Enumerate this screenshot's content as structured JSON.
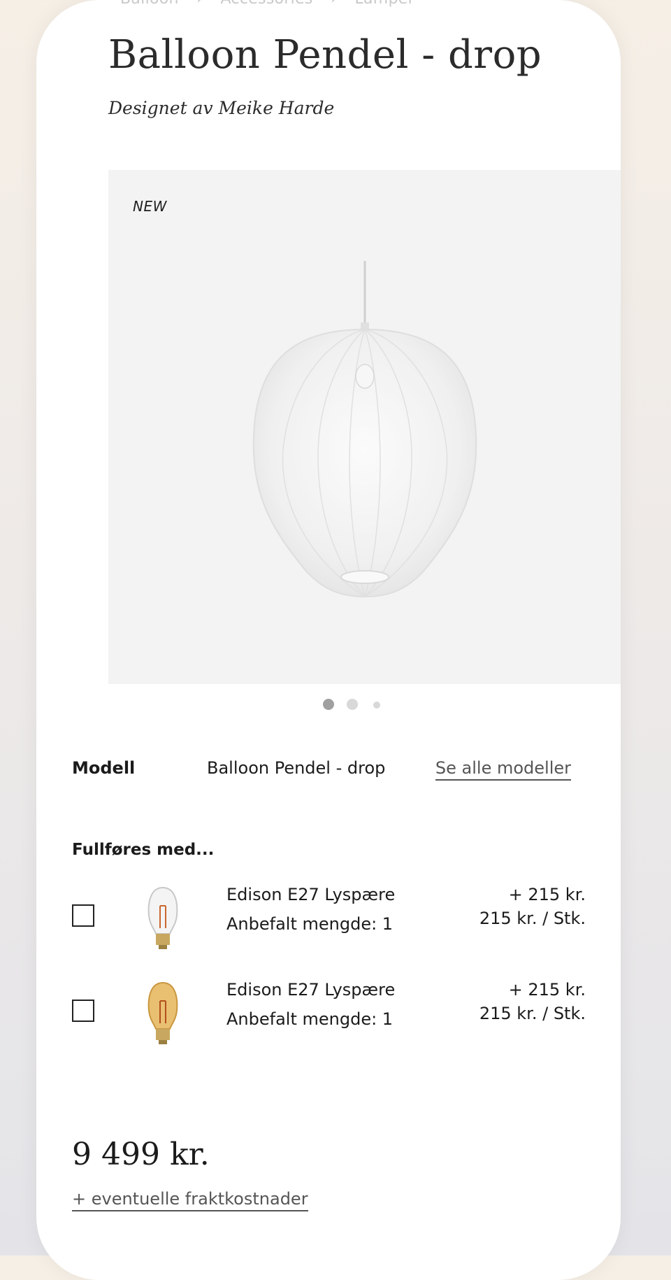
{
  "breadcrumb": {
    "items": [
      "Balloon",
      "Accessories",
      "Lamper"
    ],
    "separator": "›"
  },
  "product": {
    "title": "Balloon Pendel - drop",
    "designer": "Designet av Meike Harde",
    "badge": "NEW",
    "image_icon": "pendant-lamp-image",
    "gallery": {
      "slides": 3,
      "active": 0
    }
  },
  "model": {
    "label": "Modell",
    "value": "Balloon Pendel - drop",
    "link": "Se alle modeller"
  },
  "addons": {
    "title": "Fullføres med...",
    "items": [
      {
        "name": "Edison E27 Lyspære",
        "qty": "Anbefalt mengde: 1",
        "price": "+ 215 kr.",
        "unit_price": "215 kr. / Stk.",
        "icon": "clear-bulb-icon",
        "checked": false
      },
      {
        "name": "Edison E27 Lyspære",
        "qty": "Anbefalt mengde: 1",
        "price": "+ 215 kr.",
        "unit_price": "215 kr. / Stk.",
        "icon": "amber-bulb-icon",
        "checked": false
      }
    ]
  },
  "pricing": {
    "total": "9 499 kr.",
    "shipping_link": "+ eventuelle fraktkostnader"
  },
  "colors": {
    "card": "#ffffff",
    "gallery_bg": "#f3f3f3",
    "text": "#1b1b1b",
    "link": "#555555"
  }
}
